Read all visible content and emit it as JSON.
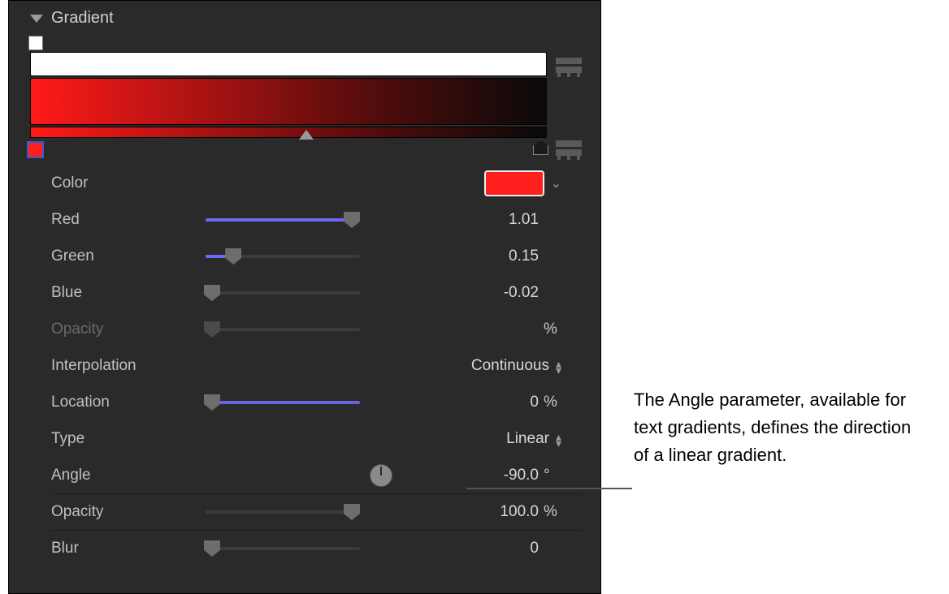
{
  "section": {
    "title": "Gradient"
  },
  "gradient": {
    "opacity_stop_color": "#ffffff",
    "color_start": "#ff1a18",
    "color_end": "#0a0a0a"
  },
  "params": {
    "color_label": "Color",
    "color_swatch": "#ff1f1c",
    "red": {
      "label": "Red",
      "value": "1.01",
      "pct": 100
    },
    "green": {
      "label": "Green",
      "value": "0.15",
      "pct": 18
    },
    "blue": {
      "label": "Blue",
      "value": "-0.02",
      "pct": 0
    },
    "opacity_rgb": {
      "label": "Opacity",
      "unit": "%"
    },
    "interpolation": {
      "label": "Interpolation",
      "value": "Continuous"
    },
    "location": {
      "label": "Location",
      "value": "0",
      "unit": "%",
      "pct": 0
    },
    "type": {
      "label": "Type",
      "value": "Linear"
    },
    "angle": {
      "label": "Angle",
      "value": "-90.0",
      "unit": "°"
    },
    "opacity": {
      "label": "Opacity",
      "value": "100.0",
      "unit": "%",
      "pct": 100
    },
    "blur": {
      "label": "Blur",
      "value": "0",
      "pct": 0
    }
  },
  "annotation": "The Angle parameter, available for text gradients, defines the direction of a linear gradient."
}
